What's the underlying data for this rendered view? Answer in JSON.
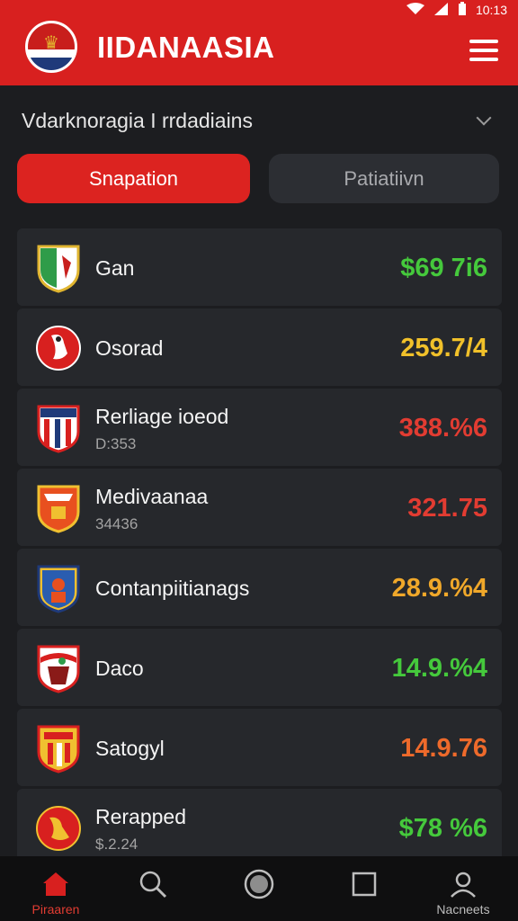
{
  "status_bar": {
    "time": "10:13"
  },
  "header": {
    "title": "IIDANAASIA"
  },
  "filter": {
    "text": "Vdarknoragia I rrdadiains"
  },
  "tabs": [
    {
      "label": "Snapation",
      "active": true
    },
    {
      "label": "Patiatiivn",
      "active": false
    }
  ],
  "items": [
    {
      "name": "Gan",
      "sub": "",
      "value": "$69 7i6",
      "color": "#45c93c",
      "icon": "green-white-shield-icon"
    },
    {
      "name": "Osorad",
      "sub": "",
      "value": "259.7/4",
      "color": "#f1c12a",
      "icon": "red-round-crest-icon"
    },
    {
      "name": "Rerliage ioeod",
      "sub": "D:353",
      "value": "388.%6",
      "color": "#e23c32",
      "icon": "striped-shield-icon"
    },
    {
      "name": "Medivaanaa",
      "sub": "34436",
      "value": "321.75",
      "color": "#e23c32",
      "icon": "orange-shield-icon"
    },
    {
      "name": "Contanpiitianags",
      "sub": "",
      "value": "28.9.%4",
      "color": "#f0a82a",
      "icon": "blue-shield-icon"
    },
    {
      "name": "Daco",
      "sub": "",
      "value": "14.9.%4",
      "color": "#45c93c",
      "icon": "red-white-shield-icon"
    },
    {
      "name": "Satogyl",
      "sub": "",
      "value": "14.9.76",
      "color": "#ee6a2b",
      "icon": "yellow-red-shield-icon"
    },
    {
      "name": "Rerapped",
      "sub": "$.2.24",
      "value": "$78 %6",
      "color": "#45c93c",
      "icon": "red-round-emblem-icon"
    }
  ],
  "nav": [
    {
      "label": "Piraaren",
      "icon": "home-icon",
      "active": true
    },
    {
      "label": "",
      "icon": "search-icon",
      "active": false
    },
    {
      "label": "",
      "icon": "record-icon",
      "active": false
    },
    {
      "label": "",
      "icon": "square-icon",
      "active": false
    },
    {
      "label": "Nacneets",
      "icon": "profile-icon",
      "active": false
    }
  ],
  "colors": {
    "brand_red": "#d8201f",
    "background": "#1c1d20",
    "card": "#26282c"
  }
}
